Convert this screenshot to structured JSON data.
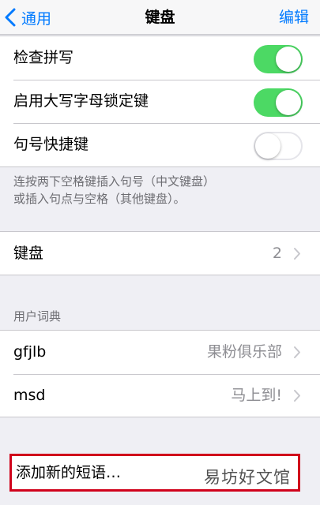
{
  "navbar": {
    "back_label": "通用",
    "title": "键盘",
    "edit_label": "编辑"
  },
  "settings": [
    {
      "label": "检查拼写",
      "state": "on"
    },
    {
      "label": "启用大写字母锁定键",
      "state": "on"
    },
    {
      "label": "句号快捷键",
      "state": "off"
    }
  ],
  "footer_note_line1": "连按两下空格键插入句号（中文键盘）",
  "footer_note_line2": "或插入句点与空格（其他键盘）。",
  "keyboards_row": {
    "label": "键盘",
    "value": "2"
  },
  "user_dictionary": {
    "header": "用户词典",
    "items": [
      {
        "shortcut": "gfjlb",
        "phrase": "果粉俱乐部"
      },
      {
        "shortcut": "msd",
        "phrase": "马上到!"
      }
    ]
  },
  "add_phrase_label": "添加新的短语…",
  "watermark": "易坊好文馆",
  "colors": {
    "accent": "#007aff",
    "toggle_on": "#4cd964",
    "highlight_border": "#d0021b"
  }
}
